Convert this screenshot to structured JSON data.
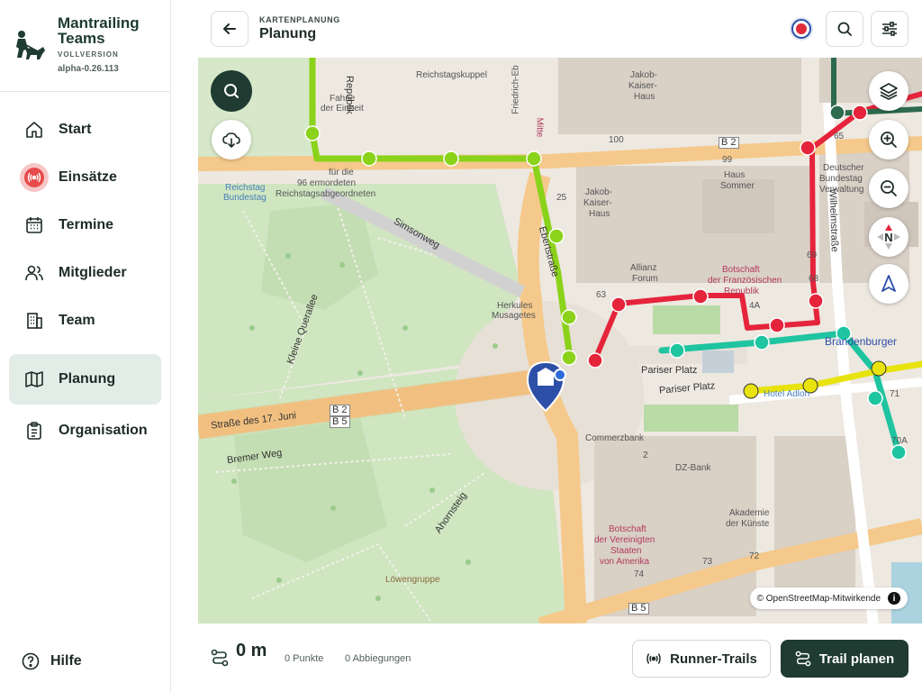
{
  "app": {
    "name": "Mantrailing Teams",
    "edition": "VOLLVERSION",
    "version": "alpha-0.26.113"
  },
  "sidebar": {
    "items": [
      {
        "label": "Start",
        "icon": "home-icon",
        "active": false
      },
      {
        "label": "Einsätze",
        "icon": "broadcast-icon",
        "active": false
      },
      {
        "label": "Termine",
        "icon": "calendar-icon",
        "active": false
      },
      {
        "label": "Mitglieder",
        "icon": "users-icon",
        "active": false
      },
      {
        "label": "Team",
        "icon": "building-icon",
        "active": false
      },
      {
        "label": "Planung",
        "icon": "map-icon",
        "active": true
      },
      {
        "label": "Organisation",
        "icon": "clipboard-icon",
        "active": false
      }
    ],
    "help_label": "Hilfe"
  },
  "header": {
    "section": "KARTENPLANUNG",
    "title": "Planung"
  },
  "map": {
    "attribution": "© OpenStreetMap-Mitwirkende",
    "compass_label": "N",
    "labels": {
      "reichstagskuppel": "Reichstagskuppel",
      "fahne_1": "Fahne",
      "fahne_2": "der Einheit",
      "republik": "Republik",
      "jakob1_1": "Jakob-",
      "jakob1_2": "Kaiser-",
      "jakob1_3": "Haus",
      "jakob2_1": "Jakob-",
      "jakob2_2": "Kaiser-",
      "jakob2_3": "Haus",
      "haus_sommer_1": "Haus",
      "haus_sommer_2": "Sommer",
      "bundestag_1": "Deutscher",
      "bundestag_2": "Bundestag",
      "bundestag_3": "Verwaltung",
      "reichstag_stop_1": "Reichstag",
      "reichstag_stop_2": "Bundestag",
      "memorial_1": "für die",
      "memorial_2": "96 ermordeten",
      "memorial_3": "Reichstagsabgeordneten",
      "simsonweg": "Simsonweg",
      "ebertstrasse": "Ebertstraße",
      "queralle": "Kleine Querallee",
      "herkules_1": "Herkules",
      "herkules_2": "Musagetes",
      "allianz_1": "Allianz",
      "allianz_2": "Forum",
      "botschaft_fr_1": "Botschaft",
      "botschaft_fr_2": "der Französischen",
      "botschaft_fr_3": "Republik",
      "wilhelmstrasse": "Wilhelmstraße",
      "brandenburger": "Brandenburger",
      "pariser_platz": "Pariser Platz",
      "adlon": "Hotel Adlon",
      "strasse_17_juni": "Straße des 17. Juni",
      "b2": "B 2",
      "b5": "B 5",
      "b2_top": "B 2",
      "b5_bottom": "B 5",
      "bremer_weg": "Bremer Weg",
      "ahornsteig": "Ahornsteig",
      "commerzbank": "Commerzbank",
      "dz_bank": "DZ-Bank",
      "akademie_1": "Akademie",
      "akademie_2": "der Künste",
      "botschaft_us_1": "Botschaft",
      "botschaft_us_2": "der Vereinigten",
      "botschaft_us_3": "Staaten",
      "botschaft_us_4": "von Amerika",
      "loewengruppe": "Löwengruppe",
      "mitte": "Mitte",
      "friedrich_ebert": "Friedrich-Eb",
      "hn_100": "100",
      "hn_99": "99",
      "hn_65": "65",
      "hn_25": "25",
      "hn_63": "63",
      "hn_69": "69",
      "hn_68": "68",
      "hn_4a": "4A",
      "hn_71": "71",
      "hn_70a": "70A",
      "hn_2": "2",
      "hn_72": "72",
      "hn_73": "73",
      "hn_74": "74"
    }
  },
  "bottom": {
    "distance": "0 m",
    "points": "0 Punkte",
    "turns": "0 Abbiegungen",
    "runner_trails_label": "Runner-Trails",
    "plan_trail_label": "Trail planen"
  },
  "colors": {
    "brand": "#1f3b32",
    "active_bg": "#e3ede8",
    "trail_green": "#8bd21a",
    "trail_teal": "#1fc4a0",
    "trail_red": "#e5243b",
    "trail_yellow": "#e8e30e"
  }
}
